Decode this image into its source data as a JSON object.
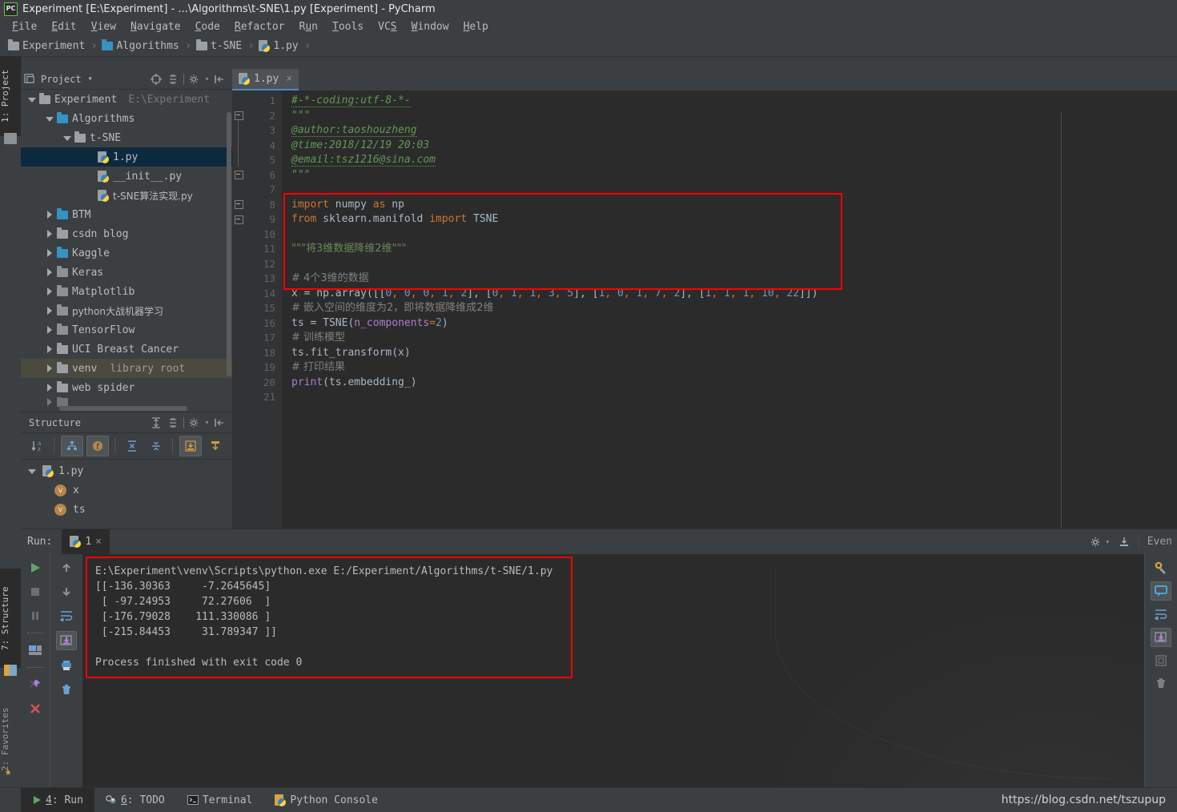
{
  "window": {
    "title": "Experiment [E:\\Experiment] - ...\\Algorithms\\t-SNE\\1.py [Experiment] - PyCharm",
    "logo_text": "PC"
  },
  "menu": {
    "items": [
      {
        "mnemonic": "F",
        "rest": "ile"
      },
      {
        "mnemonic": "E",
        "rest": "dit"
      },
      {
        "mnemonic": "V",
        "rest": "iew"
      },
      {
        "mnemonic": "N",
        "rest": "avigate"
      },
      {
        "mnemonic": "C",
        "rest": "ode"
      },
      {
        "mnemonic": "R",
        "rest": "efactor"
      },
      {
        "mnemonic": "R",
        "rest": "un",
        "pre": "R",
        "mid": "u",
        "post": "n"
      },
      {
        "mnemonic": "T",
        "rest": "ools"
      },
      {
        "mnemonic": "S",
        "rest": "VCS"
      },
      {
        "mnemonic": "W",
        "rest": "indow"
      },
      {
        "mnemonic": "H",
        "rest": "elp"
      }
    ],
    "labels": [
      "File",
      "Edit",
      "View",
      "Navigate",
      "Code",
      "Refactor",
      "Run",
      "Tools",
      "VCS",
      "Window",
      "Help"
    ]
  },
  "breadcrumb": {
    "items": [
      {
        "label": "Experiment",
        "icon": "folder-gray-icon"
      },
      {
        "label": "Algorithms",
        "icon": "folder-blue-icon"
      },
      {
        "label": "t-SNE",
        "icon": "folder-gray-icon"
      },
      {
        "label": "1.py",
        "icon": "python-file-icon"
      }
    ],
    "separator": "›"
  },
  "left_strip": {
    "project_tab": "1: Project",
    "structure_tab": "7: Structure",
    "favorites_tab": "2: Favorites"
  },
  "project_panel": {
    "title": "Project",
    "chevron": "▾",
    "tree": [
      {
        "label": "Experiment",
        "note": "E:\\Experiment",
        "indent": 0,
        "state": "expanded",
        "icon": "folder-gray-icon",
        "selected": false
      },
      {
        "label": "Algorithms",
        "indent": 1,
        "state": "expanded",
        "icon": "folder-blue-icon",
        "selected": false
      },
      {
        "label": "t-SNE",
        "indent": 2,
        "state": "expanded",
        "icon": "folder-gray-icon",
        "selected": false
      },
      {
        "label": "1.py",
        "indent": 4,
        "state": "leaf",
        "icon": "python-file-icon",
        "selected": true
      },
      {
        "label": "__init__.py",
        "indent": 4,
        "state": "leaf",
        "icon": "python-file-icon",
        "selected": false
      },
      {
        "label": "t-SNE算法实现.py",
        "indent": 4,
        "state": "leaf",
        "icon": "python-file-icon",
        "selected": false
      },
      {
        "label": "BTM",
        "indent": 1,
        "state": "collapsed",
        "icon": "folder-blue-icon",
        "selected": false
      },
      {
        "label": "csdn blog",
        "indent": 1,
        "state": "collapsed",
        "icon": "folder-gray-icon",
        "selected": false
      },
      {
        "label": "Kaggle",
        "indent": 1,
        "state": "collapsed",
        "icon": "folder-blue-icon",
        "selected": false
      },
      {
        "label": "Keras",
        "indent": 1,
        "state": "collapsed",
        "icon": "folder-module-icon",
        "selected": false
      },
      {
        "label": "Matplotlib",
        "indent": 1,
        "state": "collapsed",
        "icon": "folder-module-icon",
        "selected": false
      },
      {
        "label": "python大战机器学习",
        "indent": 1,
        "state": "collapsed",
        "icon": "folder-module-icon",
        "selected": false
      },
      {
        "label": "TensorFlow",
        "indent": 1,
        "state": "collapsed",
        "icon": "folder-module-icon",
        "selected": false
      },
      {
        "label": "UCI Breast Cancer",
        "indent": 1,
        "state": "collapsed",
        "icon": "folder-gray-icon",
        "selected": false
      },
      {
        "label": "venv",
        "note": "library root",
        "indent": 1,
        "state": "collapsed",
        "icon": "folder-gray-icon",
        "selected": false,
        "highlight": true
      },
      {
        "label": "web spider",
        "indent": 1,
        "state": "collapsed",
        "icon": "folder-gray-icon",
        "selected": false
      }
    ]
  },
  "structure_panel": {
    "title": "Structure",
    "rows": [
      {
        "label": "1.py",
        "icon": "python-file-icon",
        "kind": "file",
        "indent": 0,
        "state": "expanded"
      },
      {
        "label": "x",
        "icon": "variable-badge-icon",
        "kind": "variable",
        "indent": 1,
        "state": "leaf"
      },
      {
        "label": "ts",
        "icon": "variable-badge-icon",
        "kind": "variable",
        "indent": 1,
        "state": "leaf"
      }
    ],
    "toolbar": [
      "sort-alphabetically-icon",
      "show-inherited-icon",
      "show-fields-icon",
      "expand-all-icon",
      "collapse-all-icon",
      "autoscroll-to-source-icon",
      "autoscroll-from-source-icon"
    ]
  },
  "editor": {
    "tab_label": "1.py",
    "tab_close": "×",
    "line_numbers": [
      1,
      2,
      3,
      4,
      5,
      6,
      7,
      8,
      9,
      10,
      11,
      12,
      13,
      14,
      15,
      16,
      17,
      18,
      19,
      20,
      21
    ],
    "lines": [
      {
        "n": 1,
        "text": "#-*-coding:utf-8-*-"
      },
      {
        "n": 2,
        "text": "\"\"\""
      },
      {
        "n": 3,
        "text": "@author:taoshouzheng"
      },
      {
        "n": 4,
        "text": "@time:2018/12/19 20:03"
      },
      {
        "n": 5,
        "text": "@email:tsz1216@sina.com"
      },
      {
        "n": 6,
        "text": "\"\"\""
      },
      {
        "n": 7,
        "text": ""
      },
      {
        "n": 8,
        "text": "import numpy as np"
      },
      {
        "n": 9,
        "text": "from sklearn.manifold import TSNE"
      },
      {
        "n": 10,
        "text": ""
      },
      {
        "n": 11,
        "text": "\"\"\"将3维数据降维2维\"\"\""
      },
      {
        "n": 12,
        "text": ""
      },
      {
        "n": 13,
        "text": "# 4个3维的数据"
      },
      {
        "n": 14,
        "text": "x = np.array([[0, 0, 0, 1, 2], [0, 1, 1, 3, 5], [1, 0, 1, 7, 2], [1, 1, 1, 10, 22]])"
      },
      {
        "n": 15,
        "text": "# 嵌入空间的维度为2，即将数据降维成2维"
      },
      {
        "n": 16,
        "text": "ts = TSNE(n_components=2)"
      },
      {
        "n": 17,
        "text": "# 训练模型"
      },
      {
        "n": 18,
        "text": "ts.fit_transform(x)"
      },
      {
        "n": 19,
        "text": "# 打印结果"
      },
      {
        "n": 20,
        "text": "print(ts.embedding_)"
      },
      {
        "n": 21,
        "text": ""
      }
    ]
  },
  "run_panel": {
    "label": "Run:",
    "tab_label": "1",
    "tab_close": "×",
    "events_label": "Even",
    "console_lines": [
      "E:\\Experiment\\venv\\Scripts\\python.exe E:/Experiment/Algorithms/t-SNE/1.py",
      "[[-136.30363     -7.2645645]",
      " [ -97.24953     72.27606  ]",
      " [-176.79028    111.330086 ]",
      " [-215.84453     31.789347 ]]",
      "",
      "Process finished with exit code 0"
    ],
    "left_tools": [
      "run-icon",
      "stop-icon",
      "pause-icon",
      "restore-layout-icon",
      "pin-tab-icon",
      "close-icon"
    ],
    "right_tools": [
      "up-arrow-icon",
      "down-arrow-icon",
      "soft-wrap-icon",
      "scroll-to-end-icon",
      "print-icon",
      "clear-all-icon"
    ],
    "rail_tools": [
      "settings-wrench-icon",
      "comment-bubble-icon",
      "soft-wrap-icon",
      "scroll-to-end-icon",
      "checkbox-icon",
      "trash-icon"
    ]
  },
  "statusbar": {
    "items": [
      {
        "num": "4",
        "label": "Run",
        "icon": "run-icon",
        "active": true
      },
      {
        "num": "6",
        "label": "TODO",
        "icon": "todo-icon",
        "active": false
      },
      {
        "num": "",
        "label": "Terminal",
        "icon": "terminal-icon",
        "active": false
      },
      {
        "num": "",
        "label": "Python Console",
        "icon": "python-console-icon",
        "active": false
      }
    ],
    "watermark": "https://blog.csdn.net/tszupup"
  },
  "colors": {
    "panel_bg": "#3c3f41",
    "editor_bg": "#2b2b2b",
    "gutter_bg": "#313335",
    "selection_blue": "#0d293e",
    "highlight_row": "#4a4a3f",
    "accent_tab": "#4a88c7",
    "annotation_red": "#ff0000",
    "text": "#bbbbbb",
    "code_default": "#a9b7c6",
    "keyword": "#cc7832",
    "string": "#6a8759",
    "docstring": "#629755",
    "comment": "#808080",
    "number": "#6897bb",
    "kwarg": "#aa7fd0",
    "function": "#ffc66d"
  }
}
